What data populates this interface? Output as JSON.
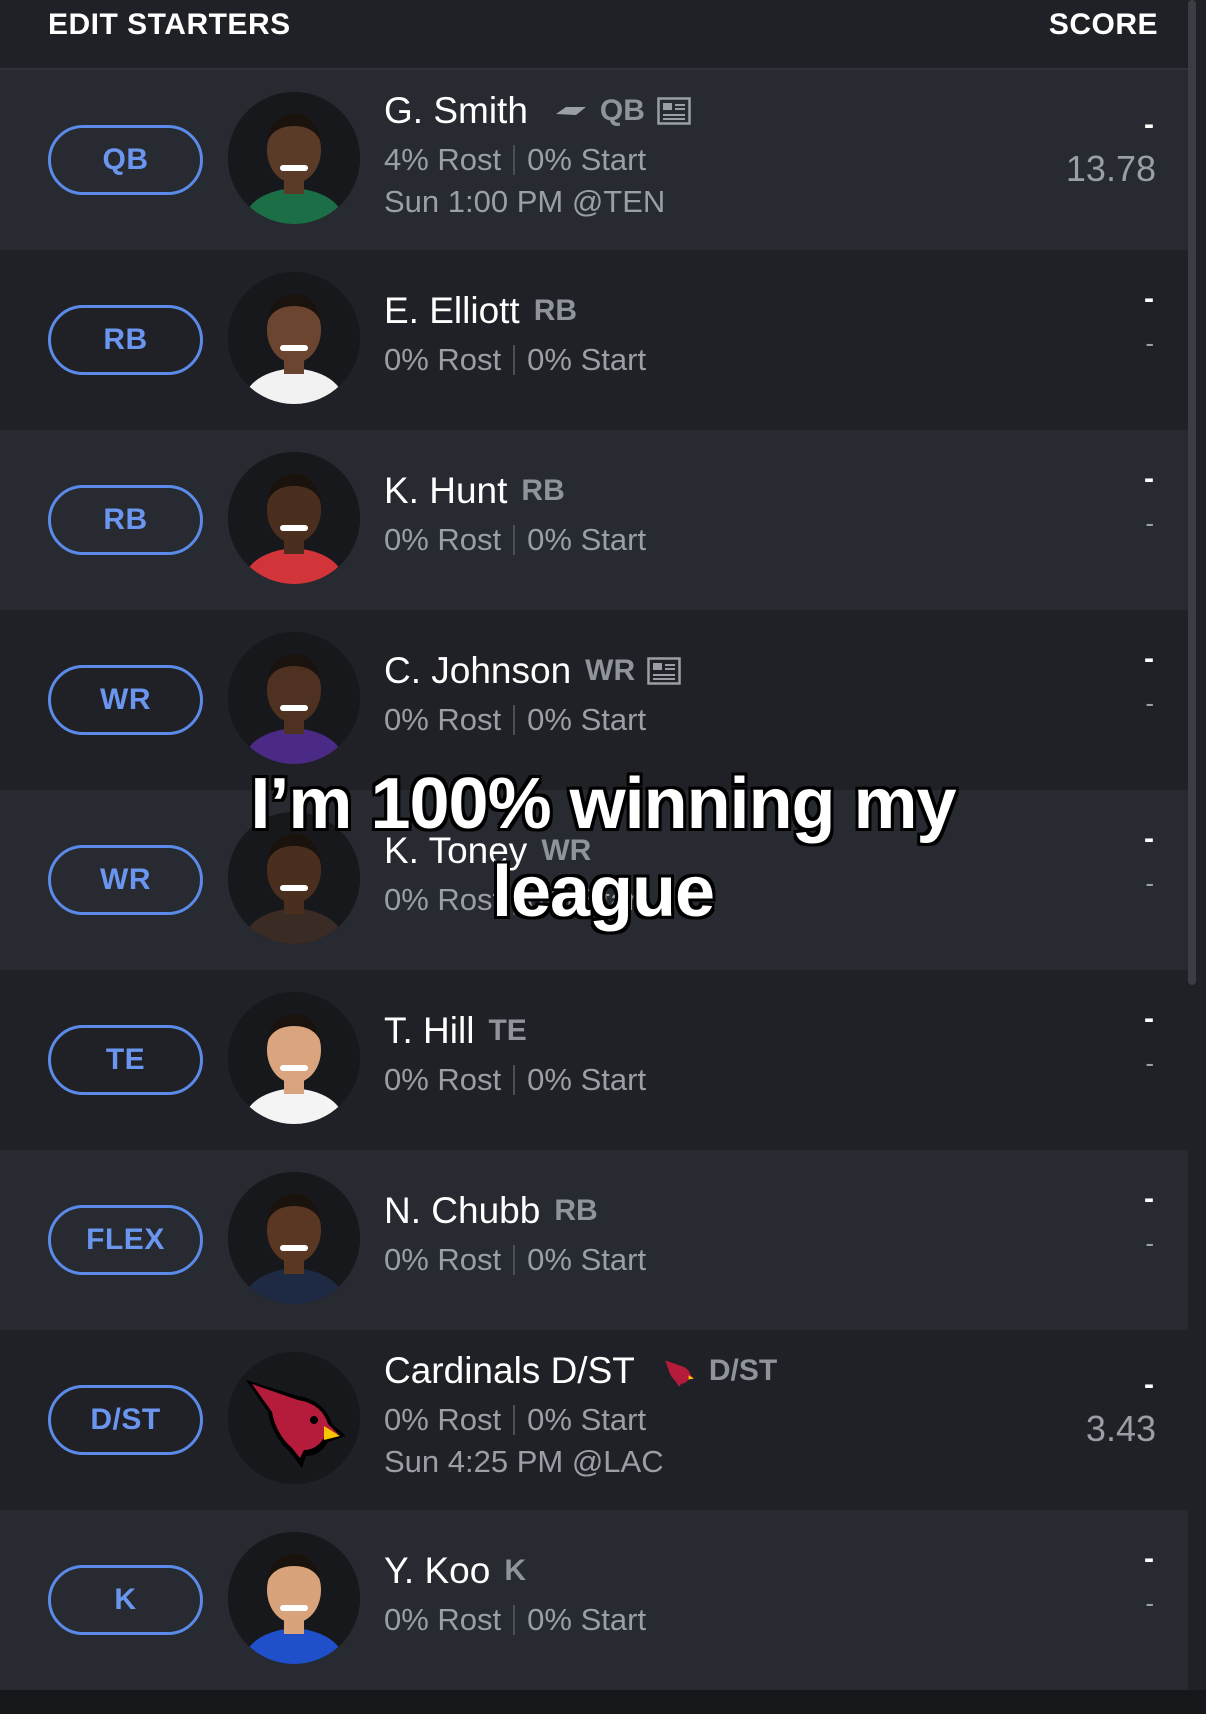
{
  "header": {
    "title": "EDIT STARTERS",
    "score_label": "SCORE"
  },
  "overlay_caption": {
    "line1": "I’m 100% winning my",
    "line2": "league"
  },
  "players": [
    {
      "slot": "QB",
      "name": "G. Smith",
      "position": "QB",
      "team_logo": "jets-logo-icon",
      "news": true,
      "rost": "4% Rost",
      "start": "0% Start",
      "game": "Sun 1:00 PM @TEN",
      "score": "-",
      "projection": "13.78",
      "skin": "#5a3b28",
      "jersey": "#1b6e45"
    },
    {
      "slot": "RB",
      "name": "E. Elliott",
      "position": "RB",
      "news": false,
      "rost": "0% Rost",
      "start": "0% Start",
      "game": "",
      "score": "-",
      "projection": "-",
      "skin": "#6b4530",
      "jersey": "#f2f2f2"
    },
    {
      "slot": "RB",
      "name": "K. Hunt",
      "position": "RB",
      "news": false,
      "rost": "0% Rost",
      "start": "0% Start",
      "game": "",
      "score": "-",
      "projection": "-",
      "skin": "#4a2e1e",
      "jersey": "#d1353a"
    },
    {
      "slot": "WR",
      "name": "C. Johnson",
      "position": "WR",
      "news": true,
      "rost": "0% Rost",
      "start": "0% Start",
      "game": "",
      "score": "-",
      "projection": "-",
      "skin": "#4e3120",
      "jersey": "#4b2a86"
    },
    {
      "slot": "WR",
      "name": "K. Toney",
      "position": "WR",
      "news": false,
      "rost": "0% Rost",
      "start": "0% Start",
      "game": "",
      "score": "-",
      "projection": "-",
      "skin": "#4a2e1e",
      "jersey": "#3a2b25"
    },
    {
      "slot": "TE",
      "name": "T. Hill",
      "position": "TE",
      "news": false,
      "rost": "0% Rost",
      "start": "0% Start",
      "game": "",
      "score": "-",
      "projection": "-",
      "skin": "#d9a47e",
      "jersey": "#f4f4f4"
    },
    {
      "slot": "FLEX",
      "name": "N. Chubb",
      "position": "RB",
      "news": false,
      "rost": "0% Rost",
      "start": "0% Start",
      "game": "",
      "score": "-",
      "projection": "-",
      "skin": "#5a3723",
      "jersey": "#1e2a44"
    },
    {
      "slot": "D/ST",
      "name": "Cardinals D/ST",
      "position": "D/ST",
      "team_logo": "cardinals-logo-icon",
      "news": false,
      "rost": "0% Rost",
      "start": "0% Start",
      "game": "Sun 4:25 PM @LAC",
      "score": "-",
      "projection": "3.43",
      "skin": "",
      "jersey": ""
    },
    {
      "slot": "K",
      "name": "Y. Koo",
      "position": "K",
      "news": false,
      "rost": "0% Rost",
      "start": "0% Start",
      "game": "",
      "score": "-",
      "projection": "-",
      "skin": "#d8a27a",
      "jersey": "#1f4fc9"
    }
  ],
  "colors": {
    "accent": "#5b8ae8",
    "row_dark": "#1f2126",
    "row_light": "#272a30",
    "muted": "#9a9fa6"
  }
}
